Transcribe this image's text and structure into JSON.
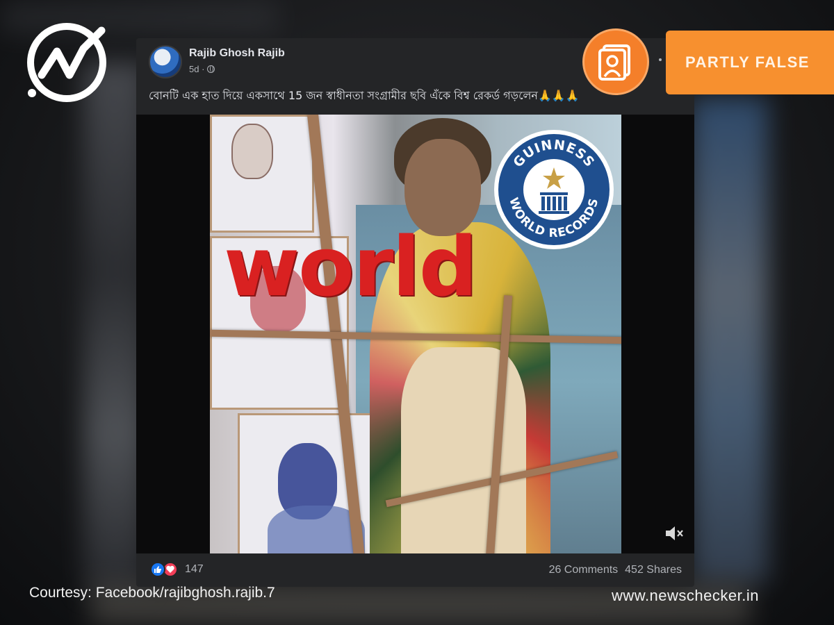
{
  "post": {
    "author": "Rajib Ghosh Rajib",
    "time": "5d ·",
    "caption": "বোনটি এক হাত দিয়ে একসাথে 15 জন স্বাধীনতা সংগ্রামীর ছবি এঁকে বিশ্ব রেকর্ড গড়লেন🙏🙏🙏",
    "overlay_text": "world",
    "badge": {
      "top": "GUINNESS",
      "bottom": "WORLD RECORDS"
    },
    "reaction_count": "147",
    "comments": "26 Comments",
    "shares": "452 Shares"
  },
  "rating": {
    "label": "PARTLY FALSE",
    "color": "#f7902f"
  },
  "footer": {
    "courtesy": "Courtesy: Facebook/rajibghosh.rajib.7",
    "site": "www.newschecker.in"
  },
  "icons": [
    "newschecker-logo-icon",
    "globe-icon",
    "guinness-logo-icon",
    "mute-icon",
    "like-icon",
    "love-icon",
    "image-frame-icon"
  ]
}
